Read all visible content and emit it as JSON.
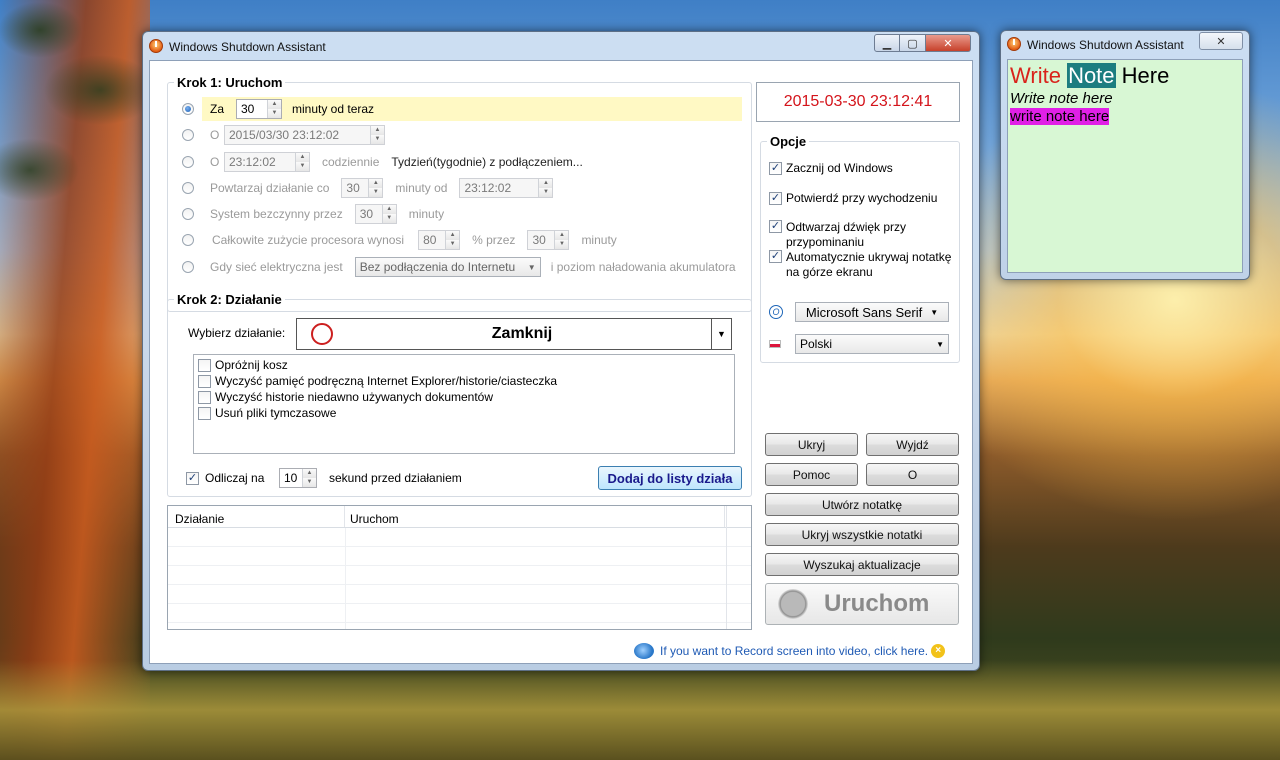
{
  "main_window": {
    "title": "Windows Shutdown Assistant",
    "datetime": "2015-03-30 23:12:41",
    "step1": {
      "title": "Krok 1: Uruchom",
      "row1": {
        "label": "Za",
        "value": "30",
        "suffix": "minuty od teraz"
      },
      "row2": {
        "label": "O",
        "value": "2015/03/30   23:12:02"
      },
      "row3": {
        "label": "O",
        "value": "23:12:02",
        "mid": "codziennie",
        "suffix": "Tydzień(tygodnie) z podłączeniem..."
      },
      "row4": {
        "label": "Powtarzaj działanie co",
        "value": "30",
        "mid": "minuty od",
        "time": "23:12:02"
      },
      "row5": {
        "label": "System bezczynny przez",
        "value": "30",
        "suffix": "minuty"
      },
      "row6": {
        "label": "Całkowite zużycie procesora wynosi",
        "value": "80",
        "mid": "% przez",
        "value2": "30",
        "suffix": "minuty"
      },
      "row7": {
        "label": "Gdy sieć elektryczna jest",
        "select": "Bez podłączenia do Internetu",
        "suffix": "i poziom naładowania akumulatora"
      }
    },
    "step2": {
      "title": "Krok 2: Działanie",
      "choose_label": "Wybierz działanie:",
      "action": "Zamknij",
      "tasks": [
        {
          "label": "Opróżnij kosz",
          "checked": false
        },
        {
          "label": "Wyczyść pamięć podręczną Internet Explorer/historie/ciasteczka",
          "checked": false
        },
        {
          "label": "Wyczyść historie niedawno używanych dokumentów",
          "checked": false
        },
        {
          "label": "Usuń pliki tymczasowe",
          "checked": false
        }
      ],
      "countdown_label": "Odliczaj na",
      "countdown_value": "10",
      "countdown_suffix": "sekund przed działaniem",
      "add_button": "Dodaj do listy działa"
    },
    "table": {
      "col1": "Działanie",
      "col2": "Uruchom"
    },
    "options": {
      "title": "Opcje",
      "items": [
        {
          "label": "Zacznij od Windows",
          "checked": true
        },
        {
          "label": "Potwierdź przy wychodzeniu",
          "checked": true
        },
        {
          "label": "Odtwarzaj dźwięk przy przypominaniu",
          "checked": true
        },
        {
          "label": "Automatycznie ukrywaj notatkę na górze ekranu",
          "checked": true
        }
      ],
      "font": "Microsoft Sans Serif",
      "language": "Polski"
    },
    "buttons": {
      "hide": "Ukryj",
      "exit": "Wyjdź",
      "help": "Pomoc",
      "about": "O",
      "create_note": "Utwórz notatkę",
      "hide_notes": "Ukryj wszystkie notatki",
      "updates": "Wyszukaj aktualizacje",
      "run": "Uruchom"
    },
    "footer_link": "If you want to Record screen into video, click here."
  },
  "note_window": {
    "title": "Windows Shutdown Assistant",
    "line1_words": [
      "Write",
      "Note",
      "Here"
    ],
    "line2": "Write note here",
    "line3": "write note here"
  },
  "colors": {
    "datetime": "#d4141b",
    "note_bg": "#d8f7d4",
    "note_red": "#d9231b",
    "note_teal": "#1c7d80",
    "note_magenta": "#e020e6",
    "link": "#1f5ab4"
  }
}
